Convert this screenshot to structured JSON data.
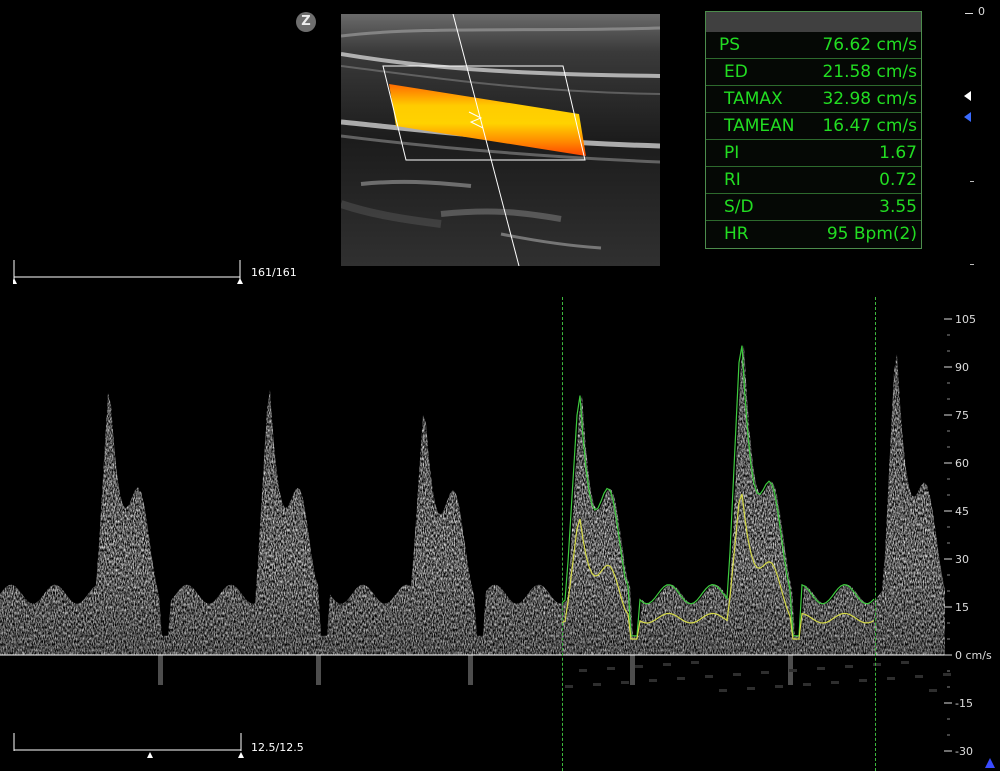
{
  "badge": {
    "zoom": "Z"
  },
  "measurements": [
    {
      "label": "PS",
      "value": "76.62 cm/s"
    },
    {
      "label": "ED",
      "value": "21.58 cm/s"
    },
    {
      "label": "TAMAX",
      "value": "32.98 cm/s"
    },
    {
      "label": "TAMEAN",
      "value": "16.47 cm/s"
    },
    {
      "label": "PI",
      "value": "1.67"
    },
    {
      "label": "RI",
      "value": "0.72"
    },
    {
      "label": "S/D",
      "value": "3.55"
    },
    {
      "label": "HR",
      "value": "95 Bpm(2)"
    }
  ],
  "depth_scale": {
    "zero": "0"
  },
  "brackets": {
    "top": "161/161",
    "bottom": "12.5/12.5"
  },
  "velocity_scale": {
    "unit": "cm/s",
    "ticks": [
      105,
      90,
      75,
      60,
      45,
      30,
      15,
      0,
      -15,
      -30
    ],
    "labels": [
      "105",
      "90",
      "75",
      "60",
      "45",
      "30",
      "15",
      "0 cm/s",
      "-15",
      "-30"
    ]
  },
  "colors": {
    "measurement_text": "#22dd22",
    "cursor_line": "#3db83d",
    "max_trace": "#3ecb3e",
    "mean_trace": "#d7dc4a",
    "flow_color": "#ffcc00"
  },
  "icons": {
    "zoom": "zoom-badge",
    "focus_white": "triangle-left",
    "focus_blue": "triangle-left",
    "bottom_cursor": "triangle-up"
  }
}
